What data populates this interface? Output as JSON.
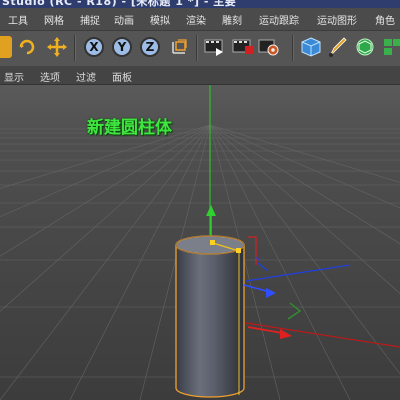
{
  "window": {
    "title": "Studio (RC - R18) - [未标题 1 *] - 主要"
  },
  "menu": {
    "items": [
      "工具",
      "网格",
      "捕捉",
      "动画",
      "模拟",
      "渲染",
      "雕刻",
      "运动跟踪",
      "运动图形",
      "角色"
    ]
  },
  "toolbar": {
    "x_label": "X",
    "y_label": "Y",
    "z_label": "Z"
  },
  "viewport_menu": {
    "items": [
      "显示",
      "选项",
      "过滤",
      "面板"
    ]
  },
  "annotation": {
    "text": "新建圆柱体"
  },
  "colors": {
    "accent_green": "#3fe63f",
    "x_axis": "#d42020",
    "y_axis": "#20c020",
    "z_axis": "#2040e0",
    "selection_outline": "#f0a030"
  }
}
